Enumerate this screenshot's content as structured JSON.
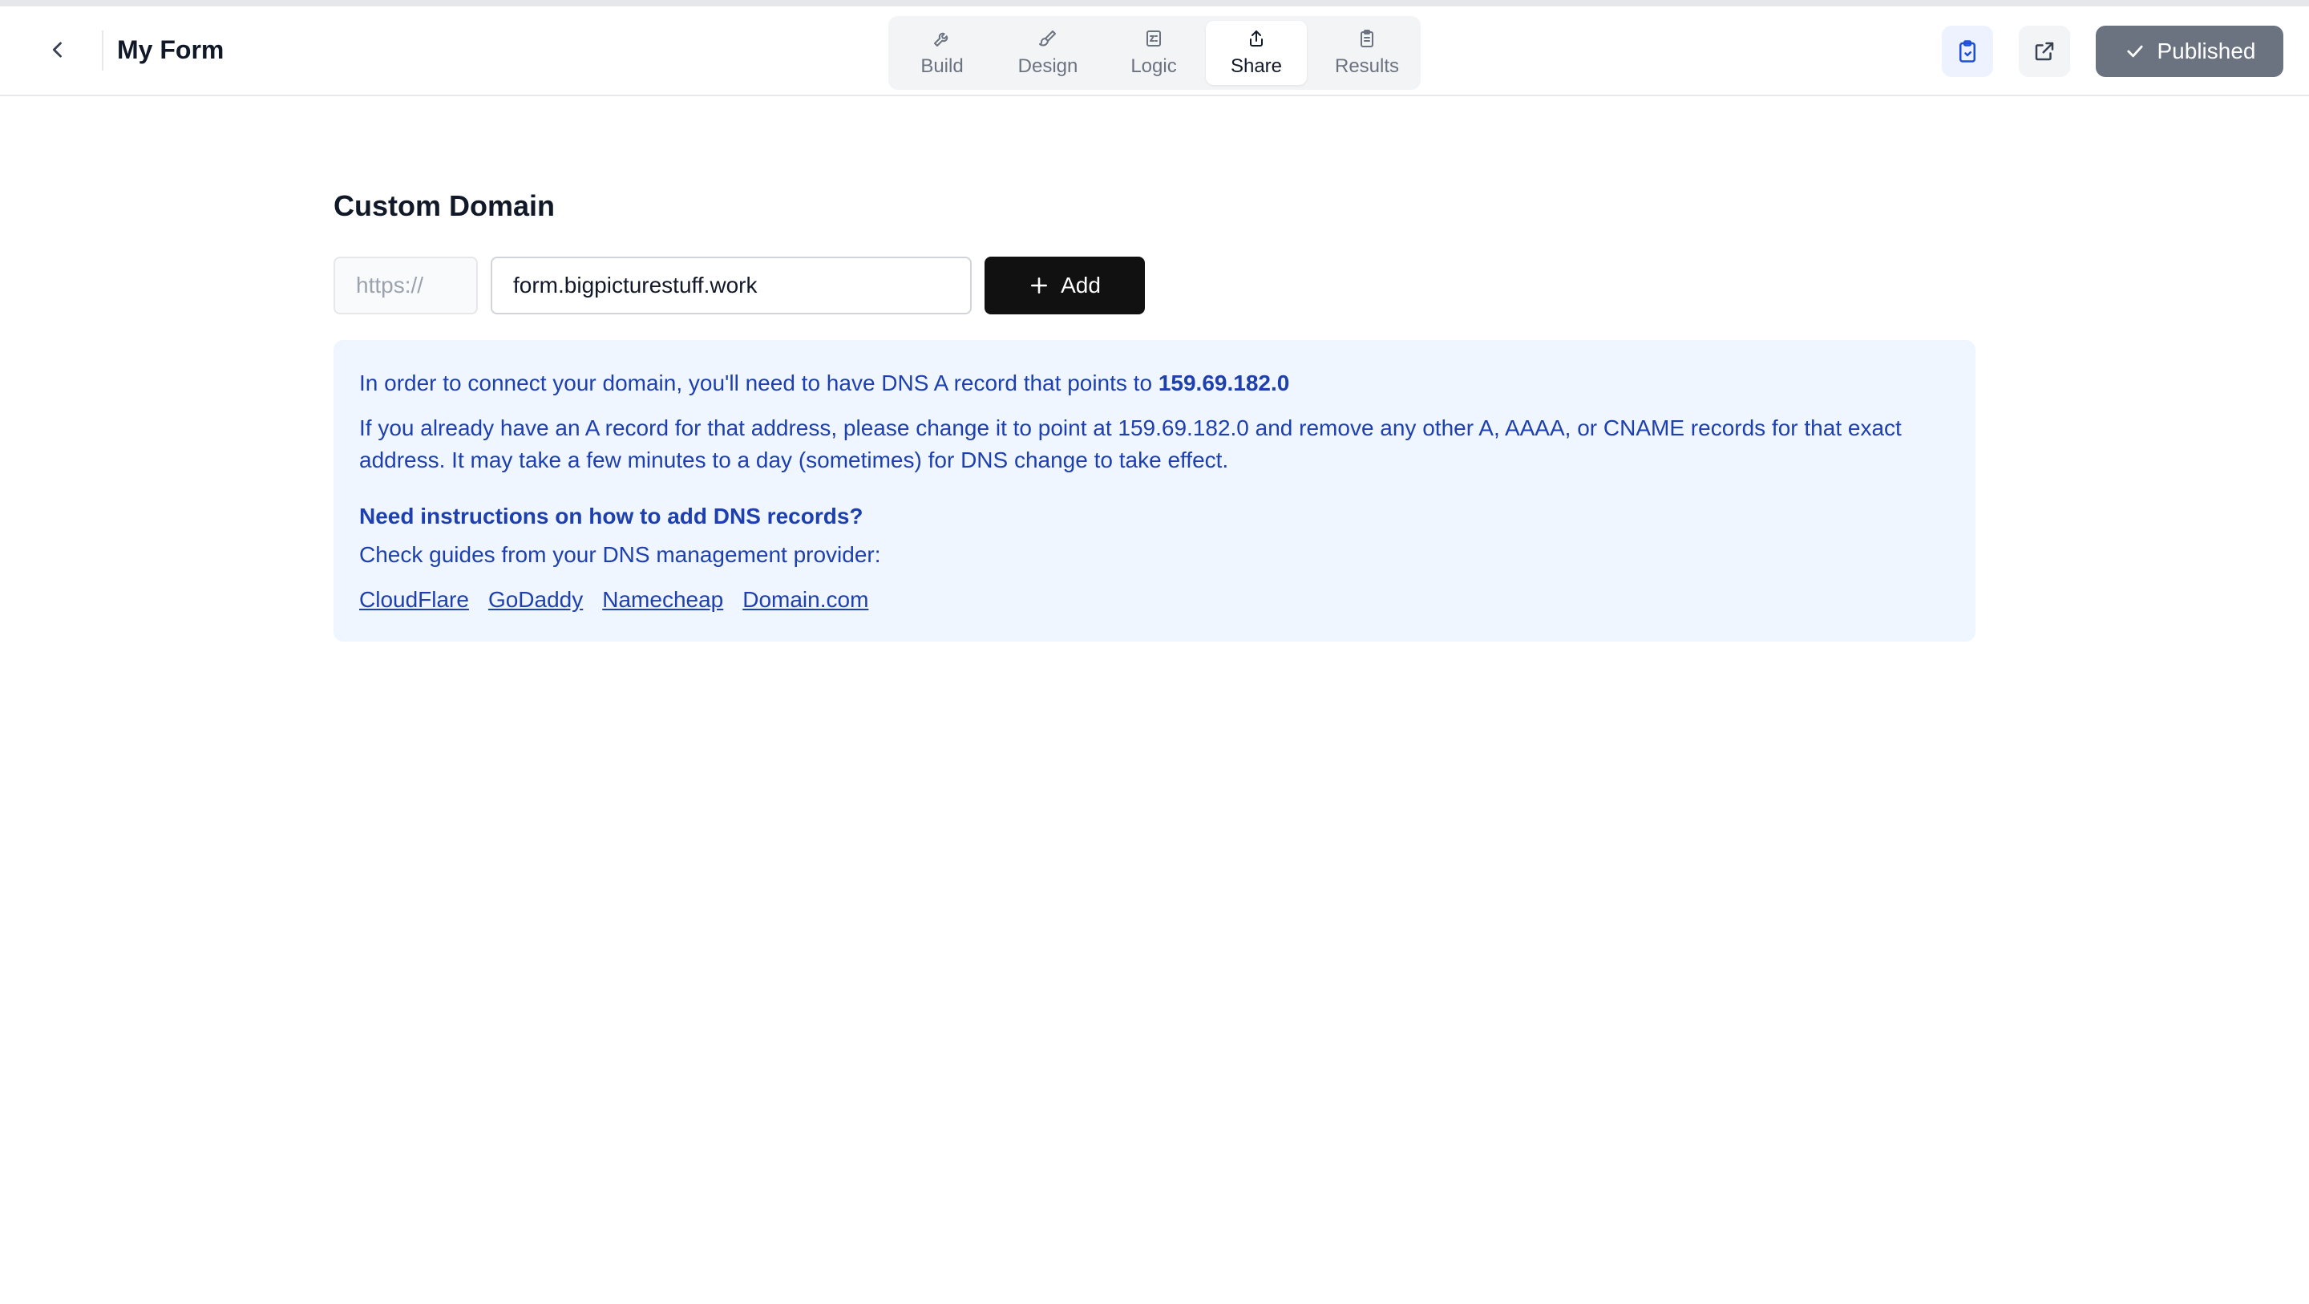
{
  "header": {
    "form_title": "My Form",
    "tabs": [
      {
        "label": "Build",
        "icon": "wrench-icon"
      },
      {
        "label": "Design",
        "icon": "paintbrush-icon"
      },
      {
        "label": "Logic",
        "icon": "logic-icon"
      },
      {
        "label": "Share",
        "icon": "share-icon"
      },
      {
        "label": "Results",
        "icon": "clipboard-icon"
      }
    ],
    "active_tab": "Share",
    "published_label": "Published"
  },
  "custom_domain": {
    "title": "Custom Domain",
    "prefix": "https://",
    "input_value": "form.bigpicturestuff.work",
    "add_label": "Add"
  },
  "info": {
    "line1_text": "In order to connect your domain, you'll need to have DNS A record that points to",
    "ip": "159.69.182.0",
    "paragraph": "If you already have an A record for that address, please change it to point at 159.69.182.0 and remove any other A, AAAA, or CNAME records for that exact address. It may take a few minutes to a day (sometimes) for DNS change to take effect.",
    "heading": "Need instructions on how to add DNS records?",
    "subtext": "Check guides from your DNS management provider:",
    "providers": [
      "CloudFlare",
      "GoDaddy",
      "Namecheap",
      "Domain.com"
    ]
  },
  "colors": {
    "info_bg": "#eff6ff",
    "info_text": "#1e40af",
    "published_bg": "#6b7280",
    "add_bg": "#111111"
  }
}
